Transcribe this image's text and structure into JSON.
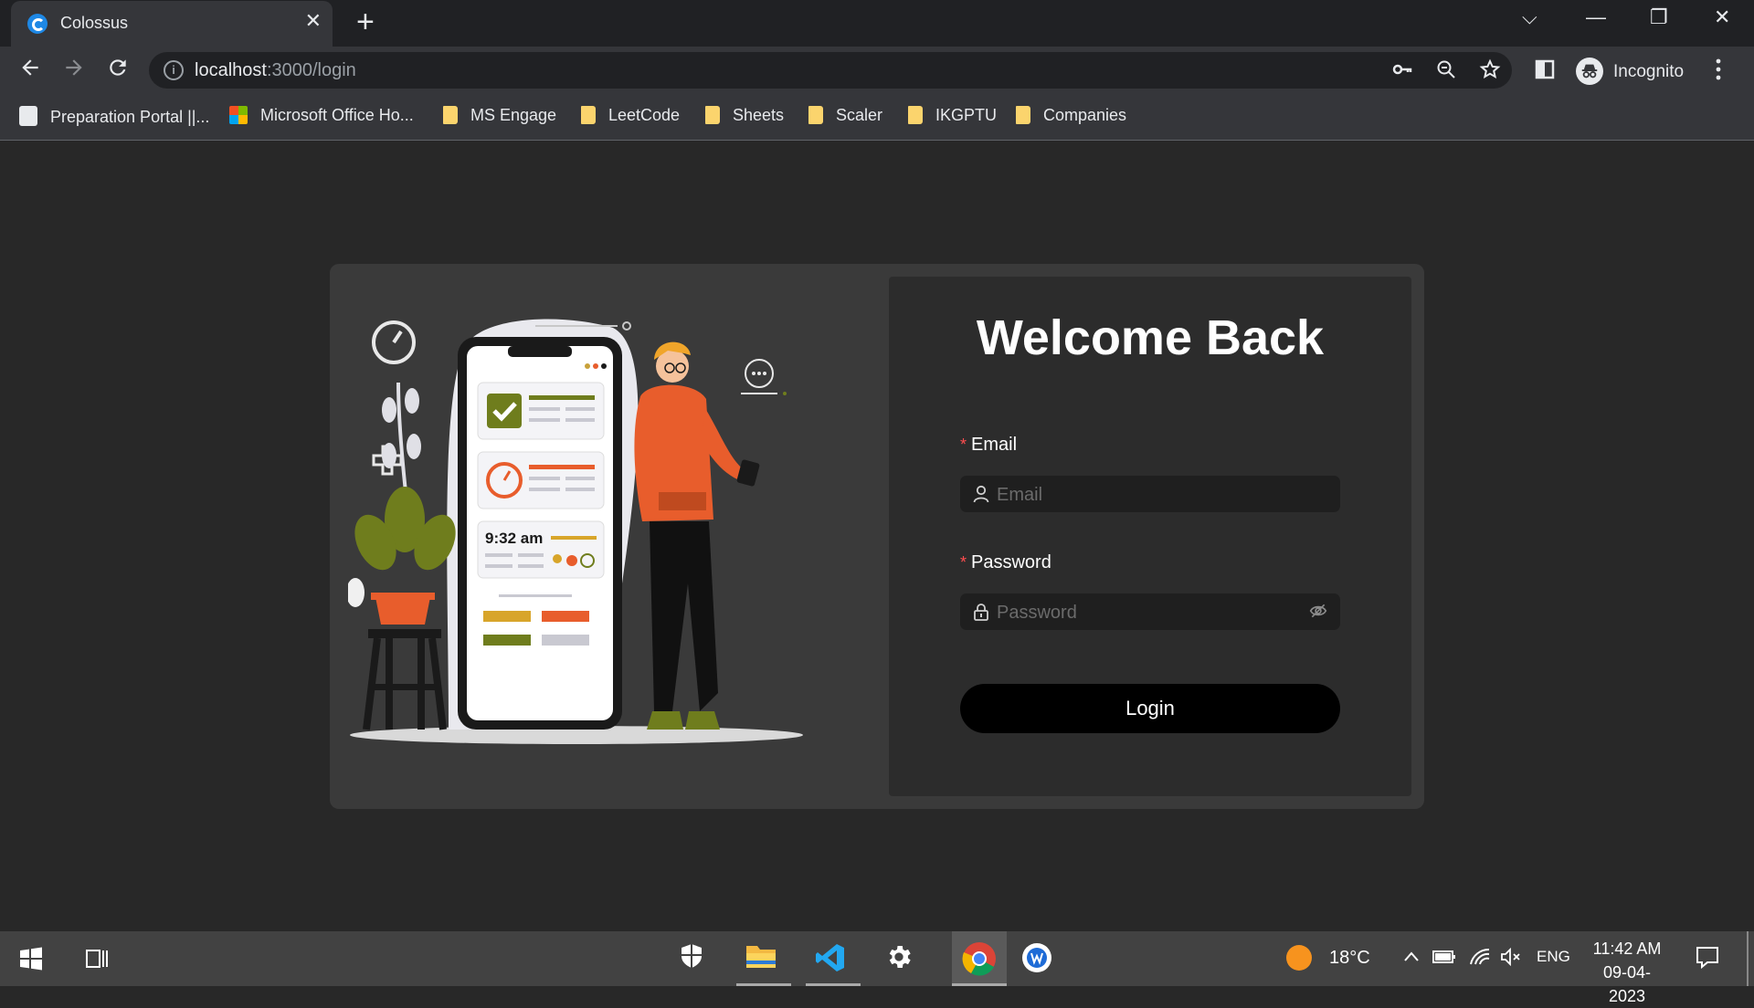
{
  "tab": {
    "title": "Colossus",
    "close": "✕",
    "new_tab": "+"
  },
  "window": {
    "dropdown": "⌵",
    "minimize": "—",
    "restore": "❐",
    "close": "✕"
  },
  "toolbar": {
    "url_host": "localhost",
    "url_path": ":3000/login",
    "profile_label": "Incognito"
  },
  "bookmarks": [
    {
      "label": "Preparation Portal ||...",
      "icon": "preparation-portal-icon"
    },
    {
      "label": "Microsoft Office Ho...",
      "icon": "microsoft-icon"
    },
    {
      "label": "MS Engage",
      "icon": "folder-icon"
    },
    {
      "label": "LeetCode",
      "icon": "folder-icon"
    },
    {
      "label": "Sheets",
      "icon": "folder-icon"
    },
    {
      "label": "Scaler",
      "icon": "folder-icon"
    },
    {
      "label": "IKGPTU",
      "icon": "folder-icon"
    },
    {
      "label": "Companies",
      "icon": "folder-icon"
    }
  ],
  "login": {
    "title": "Welcome Back",
    "email_label": "Email",
    "email_placeholder": "Email",
    "password_label": "Password",
    "password_placeholder": "Password",
    "required_mark": "*",
    "submit_label": "Login"
  },
  "illustration": {
    "phone_time": "9:32 am"
  },
  "taskbar": {
    "temperature": "18°C",
    "language": "ENG",
    "time": "11:42 AM",
    "date": "09-04-2023"
  }
}
